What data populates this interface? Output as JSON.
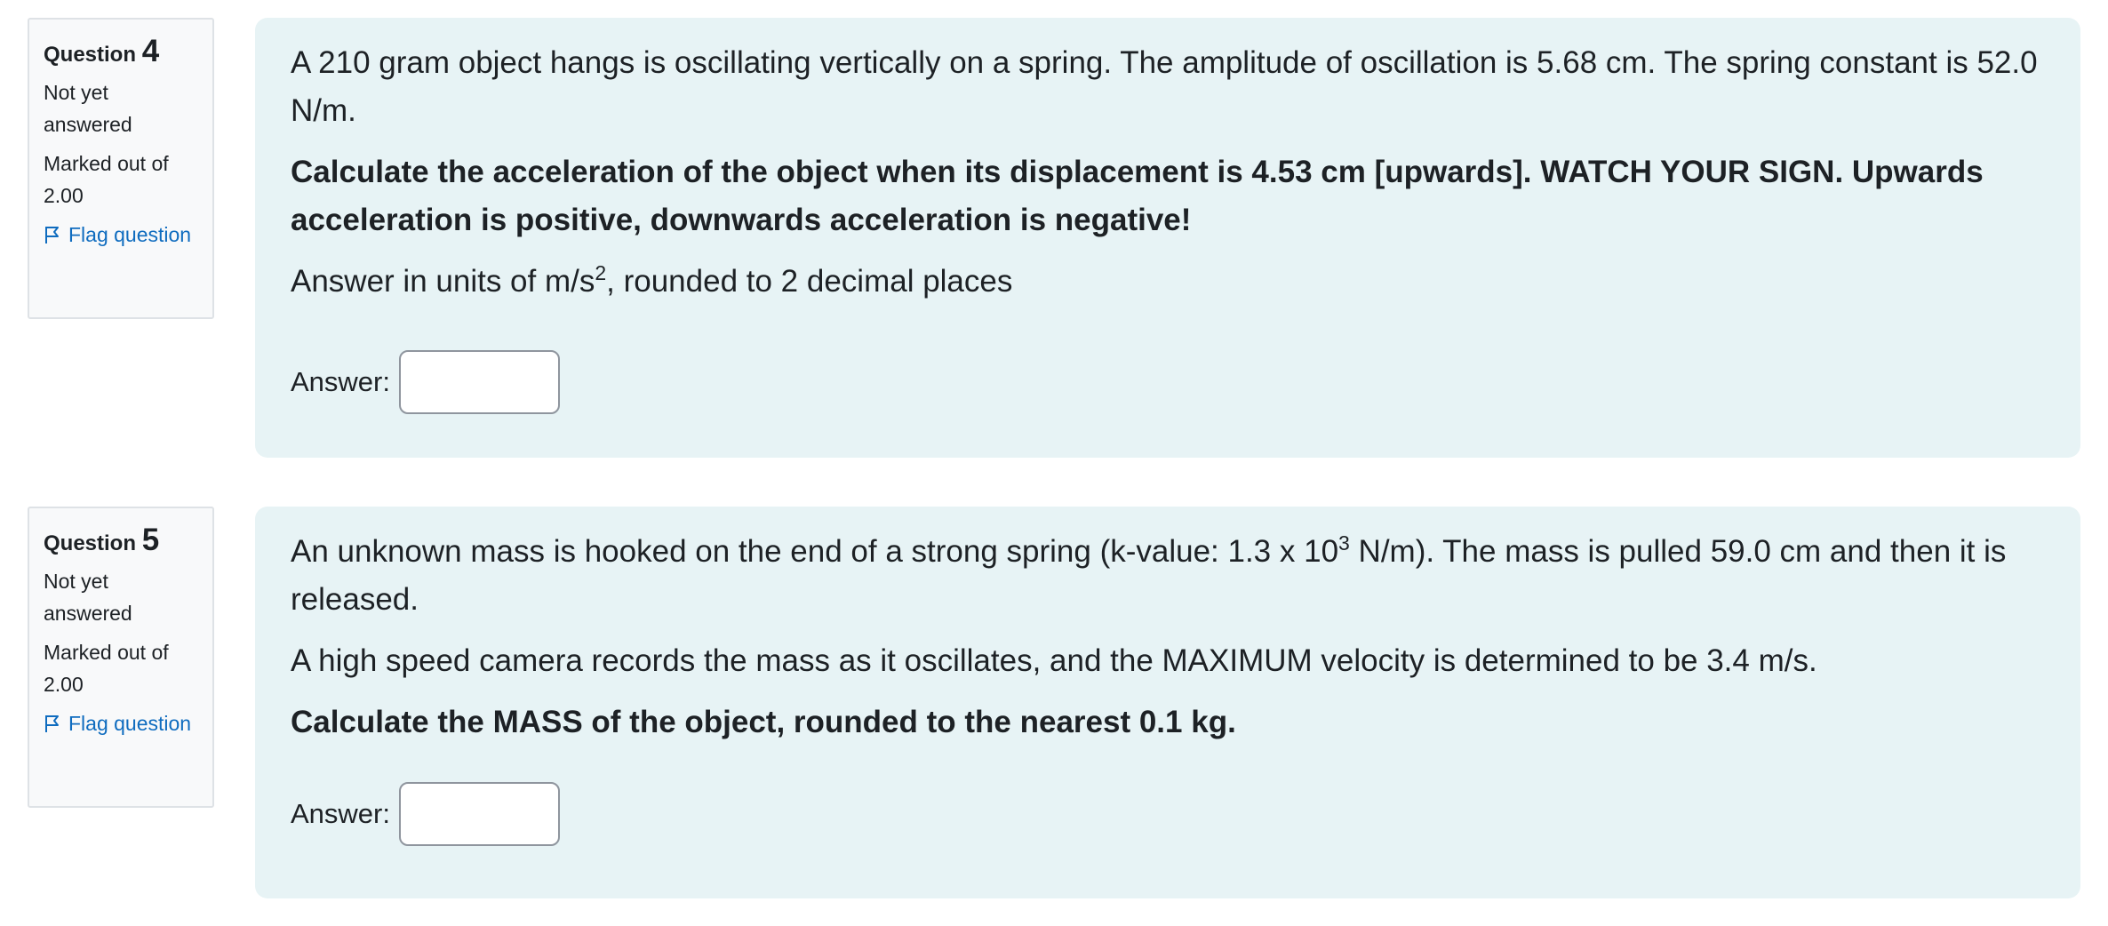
{
  "questions": [
    {
      "label": "Question",
      "number": "4",
      "status": "Not yet answered",
      "marks": "Marked out of 2.00",
      "flag_label": "Flag question",
      "flag_icon": "flag-icon",
      "p1": "A 210 gram object hangs is oscillating vertically on a spring.  The amplitude of oscillation is 5.68 cm.  The spring constant is 52.0 N/m.",
      "p2": "Calculate the acceleration of the object when its displacement is 4.53 cm [upwards].  WATCH YOUR SIGN.  Upwards acceleration is positive, downwards acceleration is negative!",
      "p3_before": "Answer in units of m/s",
      "p3_sup": "2",
      "p3_after": ", rounded to 2 decimal places",
      "answer_label": "Answer:",
      "answer_value": ""
    },
    {
      "label": "Question",
      "number": "5",
      "status": "Not yet answered",
      "marks": "Marked out of 2.00",
      "flag_label": "Flag question",
      "flag_icon": "flag-icon",
      "p1_before": "An unknown mass is hooked on the end of a strong spring (k-value:  1.3 x 10",
      "p1_sup": "3",
      "p1_after": " N/m).  The mass is pulled 59.0 cm and then it is released.",
      "p2": "A high speed camera records the mass as it oscillates, and the MAXIMUM velocity is determined to be 3.4 m/s.",
      "p3": "Calculate the MASS of the object, rounded to the nearest 0.1 kg.",
      "answer_label": "Answer:",
      "answer_value": ""
    }
  ],
  "colors": {
    "content_bg": "#e7f3f5",
    "info_bg": "#f8f9fa",
    "link": "#0f6cbf",
    "text": "#1d2125"
  }
}
